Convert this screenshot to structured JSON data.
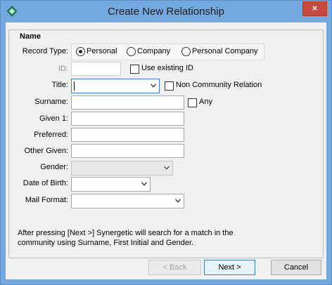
{
  "window": {
    "title": "Create New Relationship",
    "close_glyph": "×",
    "app_icon": "app-diamond-icon"
  },
  "group": {
    "title": "Name"
  },
  "record_type": {
    "label": "Record Type:",
    "options": [
      "Personal",
      "Company",
      "Personal Company"
    ],
    "selected": "Personal"
  },
  "id_field": {
    "label": "ID:",
    "value": "",
    "use_existing_label": "Use existing ID"
  },
  "title_field": {
    "label": "Title:",
    "value": "",
    "non_community_label": "Non Community Relation"
  },
  "surname": {
    "label": "Surname:",
    "value": "",
    "any_label": "Any"
  },
  "given1": {
    "label": "Given 1:",
    "value": ""
  },
  "preferred": {
    "label": "Preferred:",
    "value": ""
  },
  "other_given": {
    "label": "Other Given:",
    "value": ""
  },
  "gender": {
    "label": "Gender:",
    "value": ""
  },
  "dob": {
    "label": "Date of Birth:",
    "value": ""
  },
  "mail_format": {
    "label": "Mail Format:",
    "value": ""
  },
  "info": {
    "line1": "After pressing [Next >] Synergetic will search for a match in the",
    "line2": "community using Surname, First Initial and Gender."
  },
  "buttons": {
    "back": "< Back",
    "next": "Next >",
    "cancel": "Cancel"
  },
  "colors": {
    "titlebar": "#74a9e0",
    "close": "#c74a3f",
    "client": "#f0f0f0"
  }
}
